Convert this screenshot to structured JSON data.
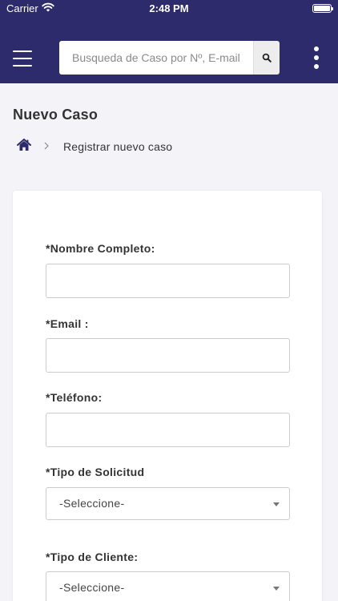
{
  "status_bar": {
    "carrier": "Carrier",
    "time": "2:48 PM"
  },
  "header": {
    "search": {
      "placeholder": "Busqueda de Caso por Nº, E-mail o"
    }
  },
  "page": {
    "title": "Nuevo Caso"
  },
  "breadcrumb": {
    "current": "Registrar nuevo caso"
  },
  "form": {
    "fields": [
      {
        "label": "*Nombre Completo:",
        "value": ""
      },
      {
        "label": "*Email :",
        "value": ""
      },
      {
        "label": "*Teléfono:",
        "value": ""
      },
      {
        "label": "*Tipo de Solicitud",
        "selected": "-Seleccione-"
      },
      {
        "label": "*Tipo de Cliente:",
        "selected": "-Seleccione-"
      }
    ]
  },
  "colors": {
    "header_bg": "#2d2b6b",
    "page_bg": "#f4f4f8"
  }
}
